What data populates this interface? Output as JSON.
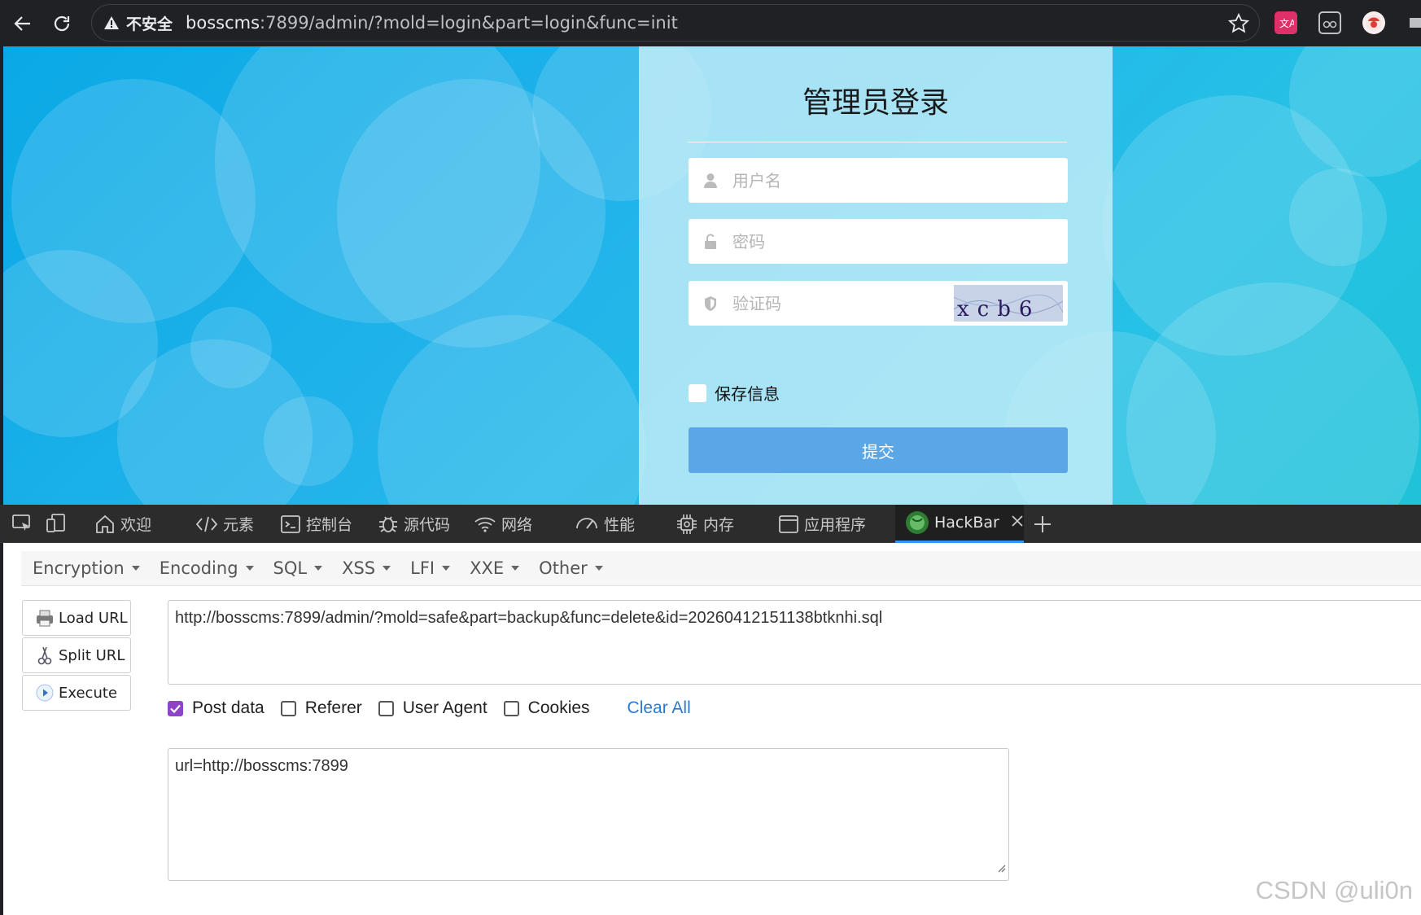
{
  "browser": {
    "insecure_label": "不安全",
    "url_host": "bosscms",
    "url_rest": ":7899/admin/?mold=login&part=login&func=init"
  },
  "login": {
    "title": "管理员登录",
    "username_placeholder": "用户名",
    "password_placeholder": "密码",
    "captcha_placeholder": "验证码",
    "captcha_text": "xcb6",
    "remember_label": "保存信息",
    "submit_label": "提交"
  },
  "devtools": {
    "tabs": [
      {
        "label": "欢迎",
        "icon": "home-icon"
      },
      {
        "label": "元素",
        "icon": "code-icon"
      },
      {
        "label": "控制台",
        "icon": "console-icon"
      },
      {
        "label": "源代码",
        "icon": "bug-icon"
      },
      {
        "label": "网络",
        "icon": "wifi-icon"
      },
      {
        "label": "性能",
        "icon": "gauge-icon"
      },
      {
        "label": "内存",
        "icon": "chip-icon"
      },
      {
        "label": "应用程序",
        "icon": "window-icon"
      },
      {
        "label": "HackBar",
        "icon": "hackbar-logo-icon",
        "active": true
      }
    ]
  },
  "hackbar": {
    "menu": [
      "Encryption",
      "Encoding",
      "SQL",
      "XSS",
      "LFI",
      "XXE",
      "Other"
    ],
    "buttons": {
      "load_url": "Load URL",
      "split_url": "Split URL",
      "execute": "Execute"
    },
    "url_value": "http://bosscms:7899/admin/?mold=safe&part=backup&func=delete&id=20260412151138btknhi.sql",
    "options": {
      "post_data": {
        "label": "Post data",
        "checked": true
      },
      "referer": {
        "label": "Referer",
        "checked": false
      },
      "user_agent": {
        "label": "User Agent",
        "checked": false
      },
      "cookies": {
        "label": "Cookies",
        "checked": false
      }
    },
    "clear_all": "Clear All",
    "post_value": "url=http://bosscms:7899"
  },
  "watermark": "CSDN @uli0n",
  "colors": {
    "accent_blue": "#3794ff",
    "submit_blue": "#5aa6e6",
    "checkbox_purple": "#8e44c6",
    "link_blue": "#2a7ad0"
  }
}
